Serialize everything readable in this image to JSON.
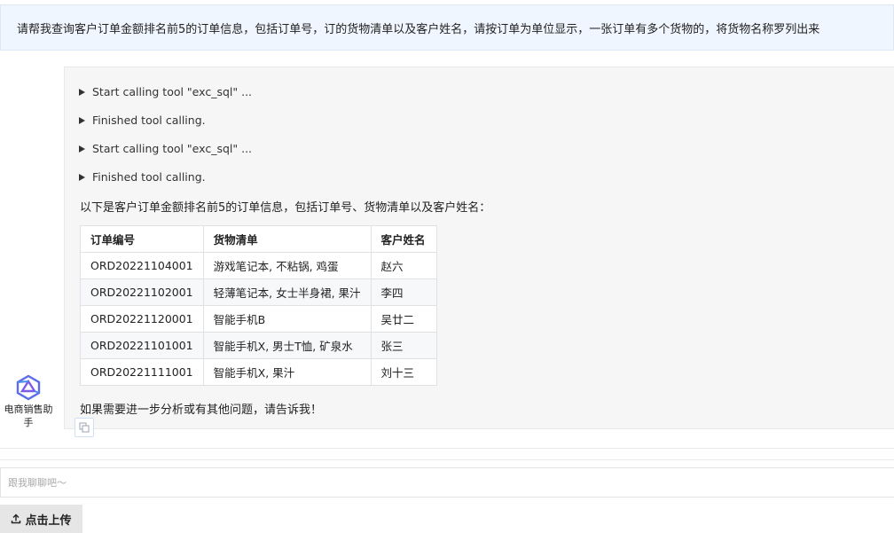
{
  "user_message": "请帮我查询客户订单金额排名前5的订单信息，包括订单号，订的货物清单以及客户姓名，请按订单为单位显示，一张订单有多个货物的，将货物名称罗列出来",
  "assistant": {
    "name": "电商销售助手",
    "icon": "assistant-logo-icon"
  },
  "tool_calls": [
    {
      "label": "Start calling tool \"exc_sql\" ..."
    },
    {
      "label": "Finished tool calling."
    },
    {
      "label": "Start calling tool \"exc_sql\" ..."
    },
    {
      "label": "Finished tool calling."
    }
  ],
  "answer": {
    "intro": "以下是客户订单金额排名前5的订单信息，包括订单号、货物清单以及客户姓名：",
    "table": {
      "headers": [
        "订单编号",
        "货物清单",
        "客户姓名"
      ],
      "rows": [
        [
          "ORD20221104001",
          "游戏笔记本, 不粘锅, 鸡蛋",
          "赵六"
        ],
        [
          "ORD20221102001",
          "轻薄笔记本, 女士半身裙, 果汁",
          "李四"
        ],
        [
          "ORD20221120001",
          "智能手机B",
          "吴廿二"
        ],
        [
          "ORD20221101001",
          "智能手机X, 男士T恤, 矿泉水",
          "张三"
        ],
        [
          "ORD20221111001",
          "智能手机X, 果汁",
          "刘十三"
        ]
      ]
    },
    "outro": "如果需要进一步分析或有其他问题，请告诉我！"
  },
  "input": {
    "placeholder": "跟我聊聊吧～",
    "value": ""
  },
  "upload": {
    "label": "点击上传",
    "icon": "upload-icon"
  },
  "colors": {
    "banner_bg": "#f0f6ff",
    "panel_bg": "#f6f6f6",
    "accent": "#5b6ee8"
  }
}
